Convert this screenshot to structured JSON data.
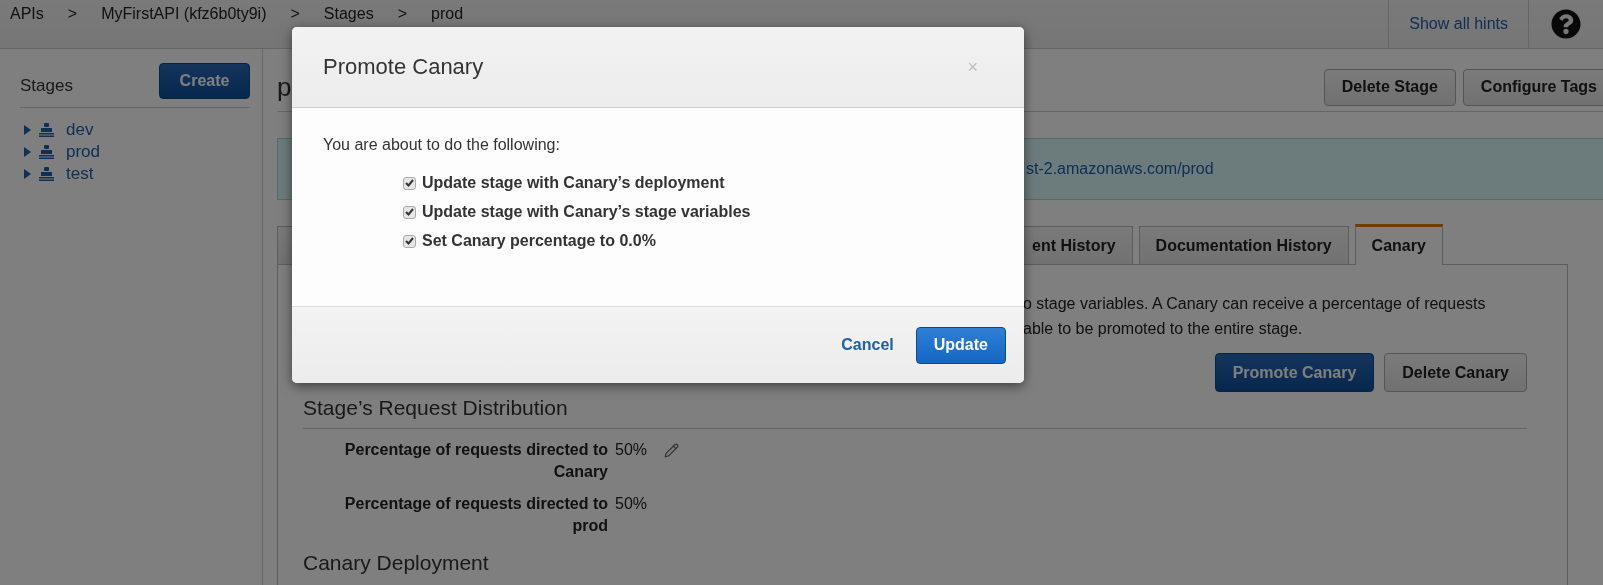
{
  "topbar": {
    "breadcrumb": [
      "APIs",
      ">",
      "MyFirstAPI (kfz6b0ty9i)",
      ">",
      "Stages",
      ">",
      "prod"
    ],
    "hints_link": "Show all hints"
  },
  "sidebar": {
    "title": "Stages",
    "create_button": "Create",
    "stages": [
      {
        "name": "dev"
      },
      {
        "name": "prod"
      },
      {
        "name": "test"
      }
    ]
  },
  "main": {
    "title": "p",
    "buttons": [
      "Delete Stage",
      "Configure Tags"
    ],
    "invoke_url": "st-2.amazonaws.com/prod",
    "tabs": [
      {
        "label": "ent History",
        "selected": false
      },
      {
        "label": "Documentation History",
        "selected": false
      },
      {
        "label": "Canary",
        "selected": true
      }
    ],
    "description": [
      "o stage variables. A Canary can receive a percentage of requests",
      "able to be promoted to the entire stage."
    ],
    "actions": [
      {
        "label": "Promote Canary",
        "kind": "primary"
      },
      {
        "label": "Delete Canary",
        "kind": "default"
      }
    ],
    "distribution": {
      "title": "Stage’s Request Distribution",
      "rows": [
        {
          "label": "Percentage of requests directed to Canary",
          "value": "50%",
          "editable": true
        },
        {
          "label": "Percentage of requests directed to prod",
          "value": "50%",
          "editable": false
        }
      ]
    },
    "next_section": "Canary Deployment"
  },
  "modal": {
    "title": "Promote Canary",
    "close": "×",
    "intro": "You are about to do the following:",
    "options": [
      {
        "label": "Update stage with Canary’s deployment",
        "checked": true
      },
      {
        "label": "Update stage with Canary’s stage variables",
        "checked": true
      },
      {
        "label": "Set Canary percentage to 0.0%",
        "checked": true
      }
    ],
    "buttons": [
      {
        "label": "Cancel",
        "kind": "link"
      },
      {
        "label": "Update",
        "kind": "primary"
      }
    ]
  }
}
